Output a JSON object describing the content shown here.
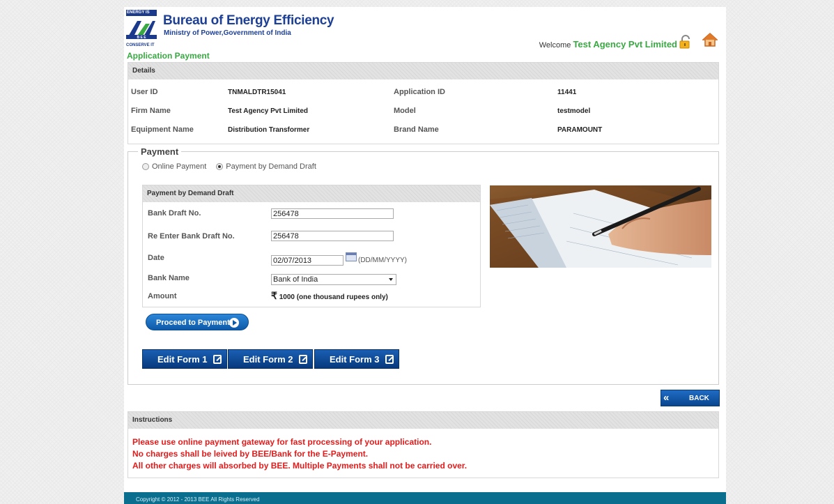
{
  "header": {
    "logo_top": "ENERGY IS LIFE",
    "logo_bottom": "CONSERVE IT",
    "org_name": "Bureau of Energy Efficiency",
    "org_sub": "Ministry of Power,Government of India",
    "welcome_prefix": "Welcome",
    "user_name": "Test Agency Pvt Limited"
  },
  "page_title": "Application Payment",
  "details": {
    "heading": "Details",
    "rows": [
      {
        "l1": "User ID",
        "v1": "TNMALDTR15041",
        "l2": "Application ID",
        "v2": "11441"
      },
      {
        "l1": "Firm Name",
        "v1": "Test Agency Pvt Limited",
        "l2": "Model",
        "v2": "testmodel"
      },
      {
        "l1": "Equipment Name",
        "v1": "Distribution Transformer",
        "l2": "Brand Name",
        "v2": "PARAMOUNT"
      }
    ]
  },
  "payment": {
    "legend": "Payment",
    "option_online": "Online Payment",
    "option_dd": "Payment by Demand Draft",
    "selected": "dd",
    "dd_heading": "Payment by Demand Draft",
    "bank_draft_label": "Bank Draft No.",
    "bank_draft_value": "256478",
    "reenter_label": "Re Enter Bank Draft No.",
    "reenter_value": "256478",
    "date_label": "Date",
    "date_value": "02/07/2013",
    "date_hint": "(DD/MM/YYYY)",
    "bank_name_label": "Bank Name",
    "bank_name_value": "Bank of India",
    "amount_label": "Amount",
    "amount_symbol": "₹",
    "amount_value": "1000 (one thousand rupees only)"
  },
  "buttons": {
    "proceed": "Proceed to Payment",
    "edit1": "Edit Form 1",
    "edit2": "Edit Form 2",
    "edit3": "Edit Form 3",
    "back": "BACK"
  },
  "instructions": {
    "heading": "Instructions",
    "lines": [
      "Please use online payment gateway for fast processing of your application.",
      "No charges shall be leived by BEE/Bank for the E-Payment.",
      "All other charges will absorbed by BEE. Multiple Payments shall not be carried over."
    ]
  },
  "footer": "Copyright © 2012 - 2013 BEE All Rights Reserved",
  "colors": {
    "accent_green": "#3aa843",
    "brand_blue": "#1d3f94",
    "button_blue": "#0d5aa8",
    "instruction_red": "#e31b1b",
    "footer_teal": "#0a6f8e"
  }
}
